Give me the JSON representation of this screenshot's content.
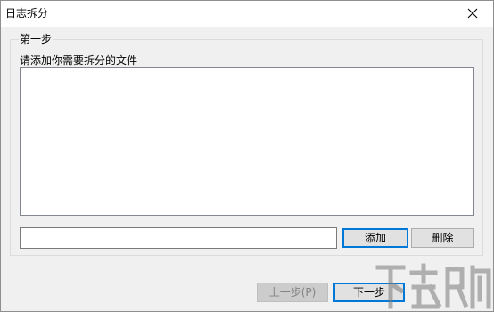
{
  "window": {
    "title": "日志拆分",
    "close_icon": "close-icon"
  },
  "step": {
    "legend": "第一步",
    "instruction": "请添加你需要拆分的文件",
    "file_list_items": [],
    "path_value": ""
  },
  "buttons": {
    "add": "添加",
    "delete": "删除",
    "prev": "上一步(P)",
    "next": "下一步"
  },
  "colors": {
    "focus_border": "#0078d7",
    "window_background": "#f0f0f0"
  },
  "watermark": {
    "icon": "site-logo-watermark"
  }
}
